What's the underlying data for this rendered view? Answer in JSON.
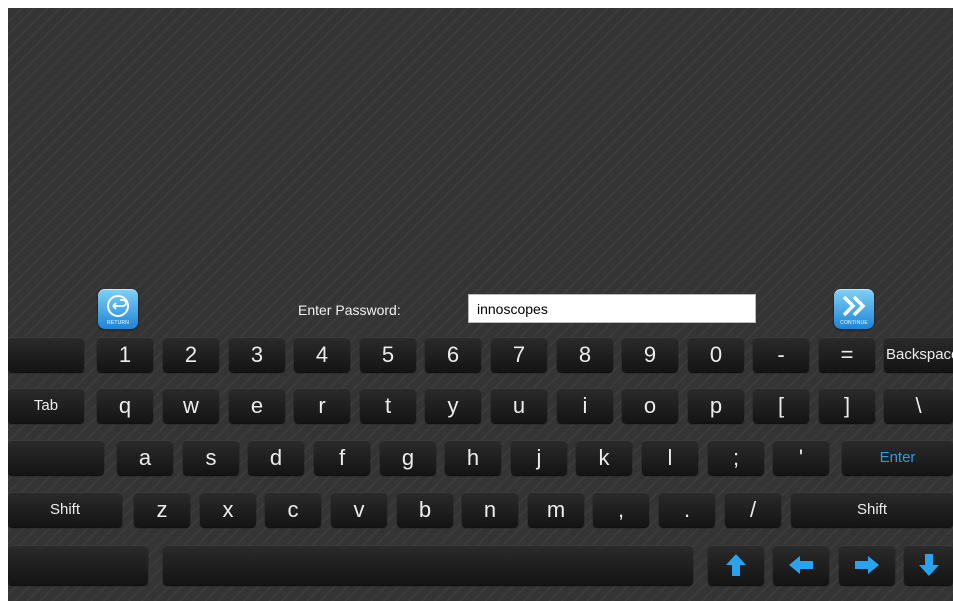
{
  "prompt": {
    "label": "Enter Password:",
    "value": "innoscopes"
  },
  "buttons": {
    "return_caption": "RETURN",
    "continue_caption": "CONTINUE",
    "return_icon": "return-icon",
    "continue_icon": "double-chevron-right-icon"
  },
  "keyboard": {
    "row1": [
      "",
      "1",
      "2",
      "3",
      "4",
      "5",
      "6",
      "7",
      "8",
      "9",
      "0",
      "-",
      "=",
      "Backspace"
    ],
    "row2": [
      "Tab",
      "q",
      "w",
      "e",
      "r",
      "t",
      "y",
      "u",
      "i",
      "o",
      "p",
      "[",
      "]",
      "\\"
    ],
    "row3": [
      "",
      "a",
      "s",
      "d",
      "f",
      "g",
      "h",
      "j",
      "k",
      "l",
      ";",
      "'",
      "Enter"
    ],
    "row4": [
      "Shift",
      "z",
      "x",
      "c",
      "v",
      "b",
      "n",
      "m",
      ",",
      ".",
      "/",
      "Shift"
    ],
    "row5_arrows": [
      "up",
      "left",
      "right",
      "down"
    ]
  },
  "colors": {
    "background": "#343434",
    "key": "#1e1e1e",
    "accent": "#2a9be8"
  }
}
